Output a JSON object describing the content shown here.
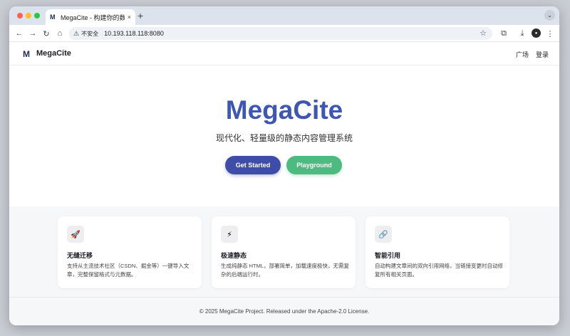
{
  "browser": {
    "tab": {
      "favicon": "M",
      "title": "MegaCite - 构建你的数字花园",
      "close": "×"
    },
    "new_tab": "+",
    "tab_menu": "⌄",
    "toolbar": {
      "back": "←",
      "forward": "→",
      "reload": "↻",
      "home": "⌂",
      "security_icon": "⚠",
      "security_label": "不安全",
      "url": "10.193.118.118:8080",
      "bookmark": "☆",
      "extensions": "⧉",
      "download": "⤓",
      "profile": "●",
      "menu": "⋮"
    }
  },
  "site": {
    "nav": {
      "logo": "M",
      "brand": "MegaCite",
      "links": [
        "广场",
        "登录"
      ]
    },
    "hero": {
      "title": "MegaCite",
      "subtitle": "现代化、轻量级的静态内容管理系统",
      "primary_button": "Get Started",
      "secondary_button": "Playground"
    },
    "features": [
      {
        "icon": "🚀",
        "icon_name": "rocket-icon",
        "title": "无缝迁移",
        "description": "支持从主流技术社区（CSDN、掘金等）一键导入文章，完整保留格式与元数据。"
      },
      {
        "icon": "⚡",
        "icon_name": "lightning-icon",
        "title": "极速静态",
        "description": "生成纯静态 HTML，部署简单，加载速度极快，无需复杂的后端运行时。"
      },
      {
        "icon": "🔗",
        "icon_name": "link-icon",
        "title": "智能引用",
        "description": "自动构建文章间的双向引用网络，当链接变更时自动修复所有相关页面。"
      }
    ],
    "footer": "© 2025 MegaCite Project. Released under the Apache-2.0 License."
  },
  "colors": {
    "brand_blue": "#3e57b2",
    "primary_button": "#3e4ea8",
    "secondary_button": "#4fba80"
  }
}
